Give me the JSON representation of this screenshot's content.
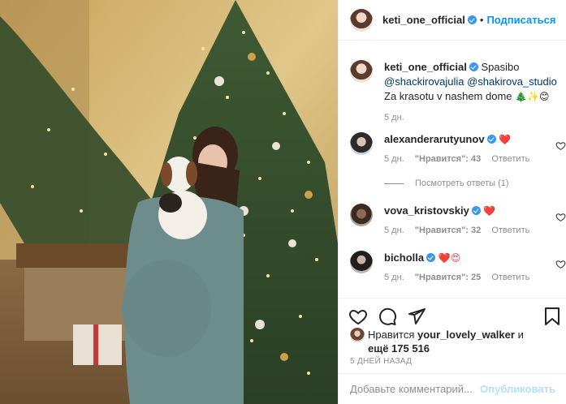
{
  "header": {
    "username": "keti_one_official",
    "separator": "•",
    "follow_label": "Подписаться"
  },
  "caption": {
    "username": "keti_one_official",
    "text_before": " Spasibo ",
    "mention1": "@shackirovajulia",
    "mention2": "@shakirova_studio",
    "text_after": " Za krasotu v nashem dome ",
    "emojis": "🎄✨😊",
    "time": "5 дн."
  },
  "comments": [
    {
      "username": "alexanderarutyunov",
      "emoji": "❤️",
      "time": "5 дн.",
      "likes": "\"Нравится\": 43",
      "reply": "Ответить"
    },
    {
      "username": "vova_kristovskiy",
      "emoji": "❤️",
      "time": "5 дн.",
      "likes": "\"Нравится\": 32",
      "reply": "Ответить"
    },
    {
      "username": "bicholla",
      "emoji": "❤️😍",
      "time": "5 дн.",
      "likes": "\"Нравится\": 25",
      "reply": "Ответить"
    }
  ],
  "view_replies": "Посмотреть ответы (1)",
  "likes": {
    "prefix": "Нравится ",
    "user": "your_lovely_walker",
    "middle": " и",
    "count": "ещё 175 516"
  },
  "posted": "5 ДНЕЙ НАЗАД",
  "add_comment": {
    "placeholder": "Добавьте комментарий...",
    "publish": "Опубликовать"
  },
  "colors": {
    "accent": "#0095f6",
    "verified": "#3897f0",
    "heart": "#ed4956",
    "muted": "#8e8e8e"
  },
  "icons": [
    "heart-icon",
    "comment-icon",
    "share-icon",
    "bookmark-icon",
    "verified-badge-icon"
  ]
}
